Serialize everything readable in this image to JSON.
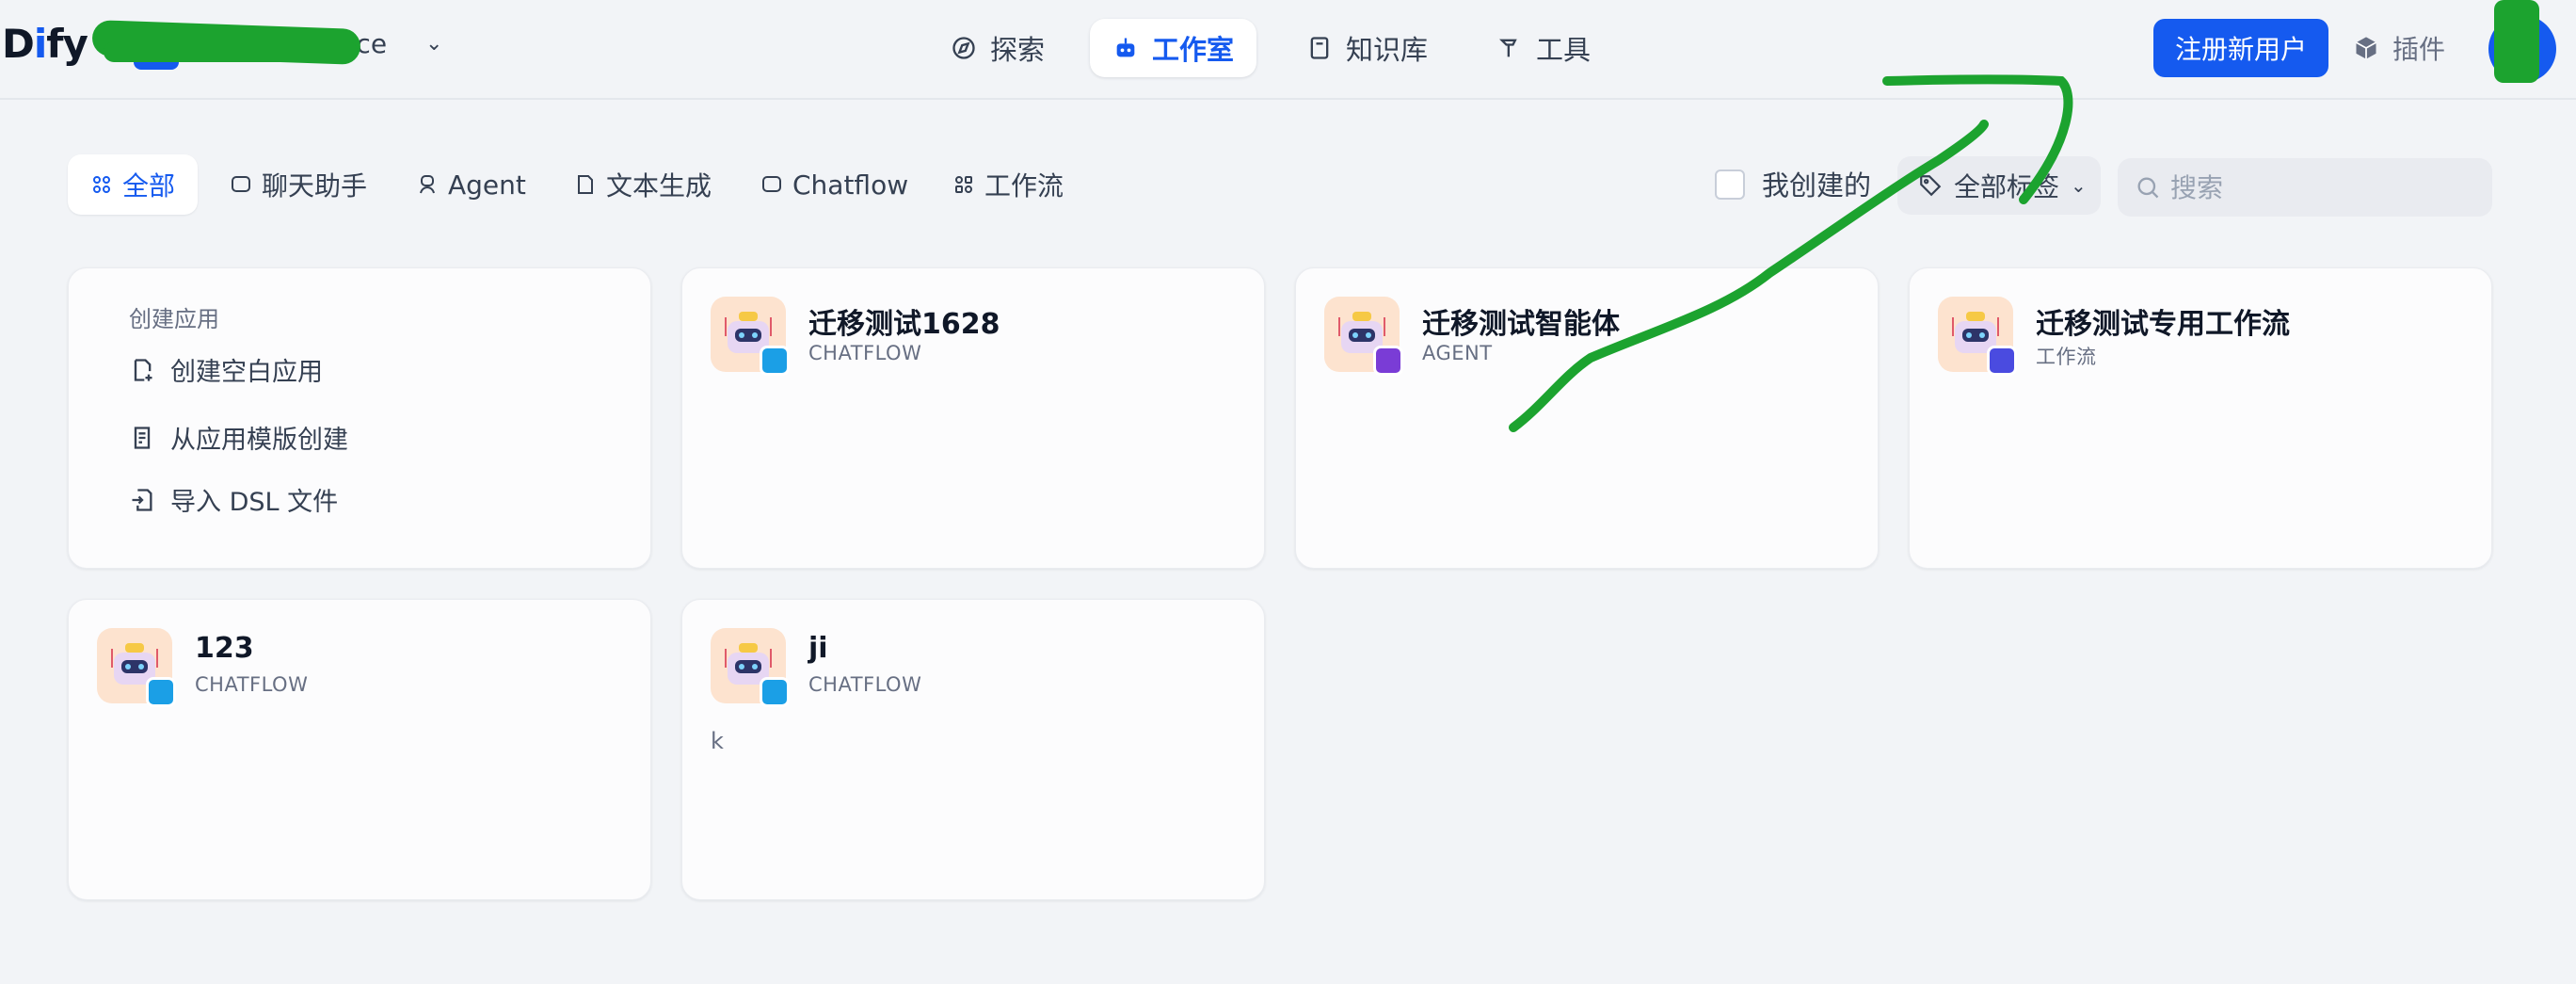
{
  "header": {
    "logo_prefix": "D",
    "logo_i": "i",
    "logo_suffix": "fy",
    "workspace_name": "Workspace",
    "nav": [
      {
        "label": "探索",
        "icon": "compass-icon",
        "active": false
      },
      {
        "label": "工作室",
        "icon": "robot-icon",
        "active": true
      },
      {
        "label": "知识库",
        "icon": "book-icon",
        "active": false
      },
      {
        "label": "工具",
        "icon": "hammer-icon",
        "active": false
      }
    ],
    "register_button": "注册新用户",
    "plugins_label": "插件"
  },
  "filters": {
    "tabs": [
      {
        "label": "全部",
        "icon": "grid-icon",
        "active": true
      },
      {
        "label": "聊天助手",
        "icon": "chat-icon",
        "active": false
      },
      {
        "label": "Agent",
        "icon": "agent-icon",
        "active": false
      },
      {
        "label": "文本生成",
        "icon": "document-icon",
        "active": false
      },
      {
        "label": "Chatflow",
        "icon": "chatflow-icon",
        "active": false
      },
      {
        "label": "工作流",
        "icon": "workflow-icon",
        "active": false
      }
    ],
    "created_by_me": "我创建的",
    "tags_label": "全部标签",
    "search_placeholder": "搜索"
  },
  "create_card": {
    "title": "创建应用",
    "items": [
      "创建空白应用",
      "从应用模版创建",
      "导入 DSL 文件"
    ]
  },
  "apps": [
    {
      "name": "迁移测试1628",
      "type": "CHATFLOW",
      "description": "",
      "badge_color": "#1b9fe6"
    },
    {
      "name": "迁移测试智能体",
      "type": "AGENT",
      "description": "",
      "badge_color": "#7a3cd6"
    },
    {
      "name": "迁移测试专用工作流",
      "type": "工作流",
      "description": "",
      "badge_color": "#4a4be0"
    },
    {
      "name": "123",
      "type": "CHATFLOW",
      "description": "",
      "badge_color": "#1b9fe6"
    },
    {
      "name": "ji",
      "type": "CHATFLOW",
      "description": "k",
      "badge_color": "#1b9fe6"
    }
  ],
  "colors": {
    "accent": "#155aef",
    "annotation_marker": "#1ca32f"
  }
}
